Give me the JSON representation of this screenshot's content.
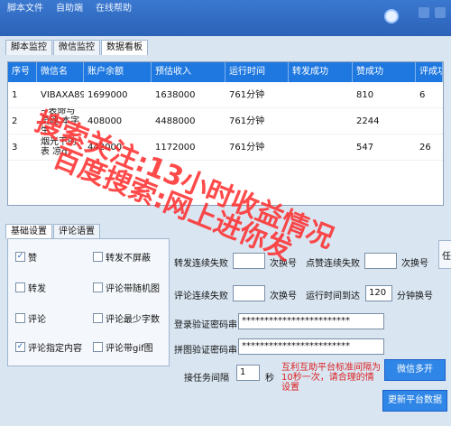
{
  "titlebar": {
    "menu": [
      "脚本文件",
      "自助端",
      "在线帮助"
    ]
  },
  "top_tabs": [
    "脚本监控",
    "微信监控",
    "数据看板"
  ],
  "table": {
    "headers": [
      "序号",
      "微信名",
      "账户余额",
      "预估收入",
      "运行时间",
      "转发成功",
      "赞成功",
      "评成功"
    ],
    "rows": [
      [
        "1",
        "VIBAXA89...",
        "1699000",
        "1638000",
        "761分钟",
        "",
        "810",
        "6"
      ],
      [
        "2",
        "~表命与灵魂 本字生",
        "408000",
        "4488000",
        "761分钟",
        "",
        "2244",
        ""
      ],
      [
        "3",
        "烟光下的表 凉q",
        "442000",
        "1172000",
        "761分钟",
        "",
        "547",
        "26"
      ]
    ]
  },
  "bottom_tabs": [
    "基础设置",
    "评论语置"
  ],
  "checkboxes": [
    {
      "label": "赞",
      "checked": true
    },
    {
      "label": "转发不屏蔽",
      "checked": false
    },
    {
      "label": "转发",
      "checked": false
    },
    {
      "label": "评论带随机图",
      "checked": false
    },
    {
      "label": "评论",
      "checked": false
    },
    {
      "label": "评论最少字数",
      "checked": false
    },
    {
      "label": "评论指定内容",
      "checked": true
    },
    {
      "label": "评论带gif图",
      "checked": false
    }
  ],
  "settings": {
    "fwd_fail_label": "转发连续失败",
    "fwd_fail_unit": "次换号",
    "like_fail_label": "点赞连续失败",
    "like_fail_unit": "次换号",
    "cmt_fail_label": "评论连续失败",
    "cmt_fail_unit": "次换号",
    "run_time_label": "运行时间到达",
    "run_time_value": "120",
    "run_time_unit": "分钟换号",
    "login_pwd_label": "登录验证密码串",
    "login_pwd_value": "************************",
    "puzzle_pwd_label": "拼图验证密码串",
    "puzzle_pwd_value": "************************",
    "interval_label": "接任务间隔",
    "interval_value": "1",
    "interval_unit": "秒",
    "right_cut_label": "任",
    "note": "互利互助平台标准间隔为10秒一次，请合理的情设置"
  },
  "buttons": {
    "save": "微信多开",
    "refresh": "更新平台数据"
  },
  "watermark": {
    "line1": "搜索关注:13小时收益情况",
    "line2": "百度搜索:网上进你发"
  }
}
